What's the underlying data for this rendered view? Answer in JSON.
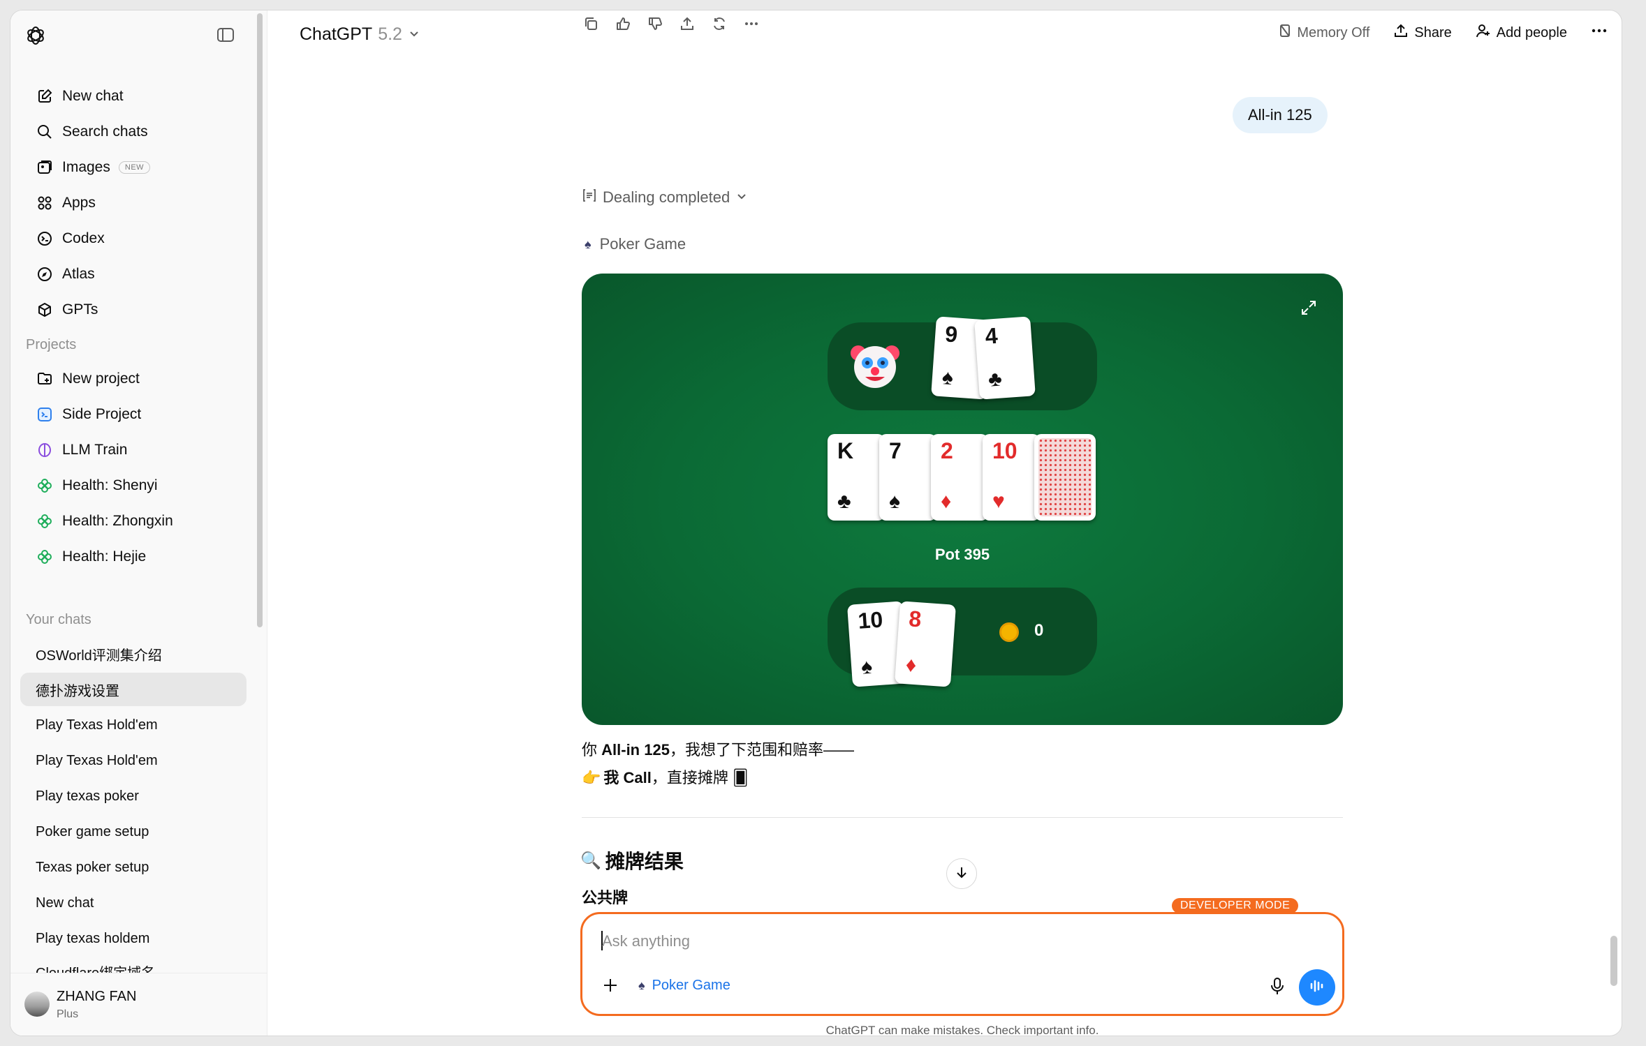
{
  "sidebar": {
    "nav": [
      {
        "label": "New chat",
        "icon": "edit-icon"
      },
      {
        "label": "Search chats",
        "icon": "search-icon"
      },
      {
        "label": "Images",
        "icon": "images-icon",
        "badge": "NEW"
      },
      {
        "label": "Apps",
        "icon": "apps-icon"
      },
      {
        "label": "Codex",
        "icon": "codex-icon"
      },
      {
        "label": "Atlas",
        "icon": "atlas-icon"
      },
      {
        "label": "GPTs",
        "icon": "gpts-icon"
      }
    ],
    "projects_title": "Projects",
    "projects": [
      {
        "label": "New project",
        "icon": "folder-plus-icon"
      },
      {
        "label": "Side Project",
        "icon": "terminal-icon"
      },
      {
        "label": "LLM Train",
        "icon": "brain-icon"
      },
      {
        "label": "Health: Shenyi",
        "icon": "clover-icon"
      },
      {
        "label": "Health: Zhongxin",
        "icon": "clover-icon"
      },
      {
        "label": "Health: Hejie",
        "icon": "clover-icon"
      }
    ],
    "chats_title": "Your chats",
    "chats": [
      "OSWorld评测集介绍",
      "德扑游戏设置",
      "Play Texas Hold'em",
      "Play Texas Hold'em",
      "Play texas poker",
      "Poker game setup",
      "Texas poker setup",
      "New chat",
      "Play texas holdem",
      "Cloudflare绑定域名"
    ],
    "user": {
      "name": "ZHANG FAN",
      "plan": "Plus"
    }
  },
  "header": {
    "model": "ChatGPT",
    "version": "5.2",
    "memory": "Memory Off",
    "share": "Share",
    "add_people": "Add people"
  },
  "conversation": {
    "user_message": "All-in 125",
    "dealing": "Dealing completed",
    "app_name": "Poker Game",
    "table": {
      "opponent_cards": [
        {
          "rank": "9",
          "suit": "♠",
          "color": "black"
        },
        {
          "rank": "4",
          "suit": "♣",
          "color": "black"
        }
      ],
      "board_cards": [
        {
          "rank": "K",
          "suit": "♣",
          "color": "black"
        },
        {
          "rank": "7",
          "suit": "♠",
          "color": "black"
        },
        {
          "rank": "2",
          "suit": "♦",
          "color": "red"
        },
        {
          "rank": "10",
          "suit": "♥",
          "color": "red"
        }
      ],
      "pot": "Pot 395",
      "player_cards": [
        {
          "rank": "10",
          "suit": "♠",
          "color": "black"
        },
        {
          "rank": "8",
          "suit": "♦",
          "color": "red"
        }
      ],
      "player_chips": "0"
    },
    "reply": {
      "line1_pre": "你 ",
      "line1_bold": "All-in 125",
      "line1_post": "，我想了下范围和赔率——",
      "line2_emoji": "👉",
      "line2_bold": "我 Call",
      "line2_post": "，直接摊牌 🂠",
      "heading_emoji": "🔍",
      "heading": "摊牌结果",
      "subheading": "公共牌"
    }
  },
  "composer": {
    "placeholder": "Ask anything",
    "dev_mode": "DEVELOPER MODE",
    "tool": "Poker Game"
  },
  "footer": "ChatGPT can make mistakes. Check important info.",
  "colors": {
    "accent_orange": "#f46b1f",
    "table_green": "#0b6a35",
    "seat_green": "#0a4d26",
    "link_blue": "#1a73e8",
    "voice_blue": "#1e88ff"
  }
}
